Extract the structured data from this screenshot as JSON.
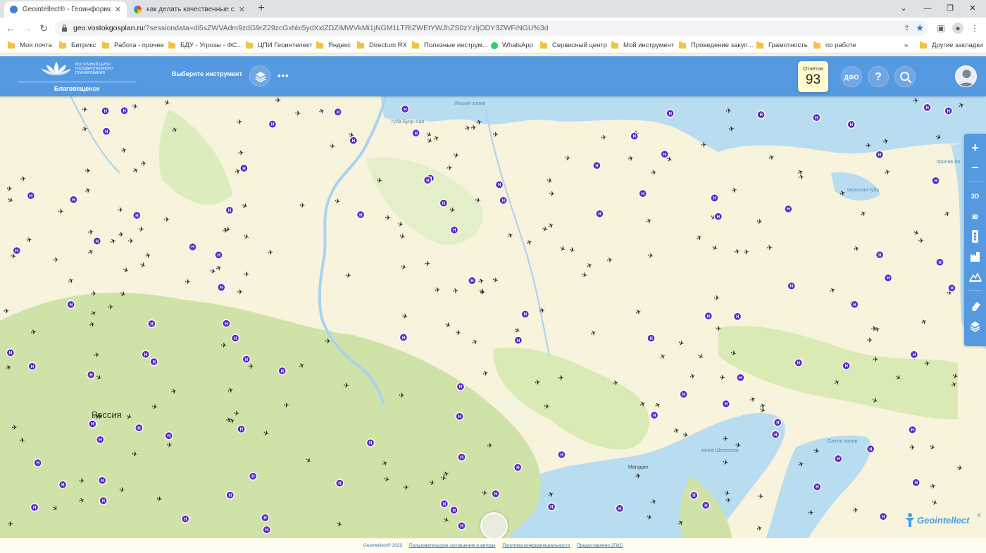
{
  "browser": {
    "tabs": [
      {
        "title": "Geointellect® - Геоинформаци",
        "active": true
      },
      {
        "title": "как делать качественные сним",
        "active": false
      }
    ],
    "url_host": "geo.vostokgosplan.ru",
    "url_path": "/?sessiondata=di5sZWVAdm9zdG9rZ29zcGxhbi5ydXxlZDZiMWVkMi1jNGM1LTRlZWEtYWJhZS0zYzljODY3ZWFiNGU%3d",
    "bookmarks": [
      {
        "label": "Моя почта",
        "icon": "folder-icon"
      },
      {
        "label": "Битрикс",
        "icon": "folder-icon"
      },
      {
        "label": "Работа - прочее",
        "icon": "folder-icon"
      },
      {
        "label": "БДУ - Угрозы - ФС...",
        "icon": "folder-icon"
      },
      {
        "label": "ЦПИ Геоинтелект",
        "icon": "folder-icon"
      },
      {
        "label": "Яндекс",
        "icon": "folder-icon"
      },
      {
        "label": "Directum RX",
        "icon": "folder-icon"
      },
      {
        "label": "Полезные инструм...",
        "icon": "folder-icon"
      },
      {
        "label": "WhatsApp",
        "icon": "whatsapp-icon"
      },
      {
        "label": "Сервисный центр",
        "icon": "folder-icon"
      },
      {
        "label": "Мой инструмент",
        "icon": "folder-icon"
      },
      {
        "label": "Проведение закуп...",
        "icon": "folder-icon"
      },
      {
        "label": "Грамотность",
        "icon": "folder-icon"
      },
      {
        "label": "по работе",
        "icon": "folder-icon"
      }
    ],
    "other_bookmarks": "Другие закладки",
    "more_bookmarks": "»"
  },
  "app": {
    "logo_text": "ВОСТОЧНЫЙ ЦЕНТР ГОСУДАРСТВЕННОГО ПЛАНИРОВАНИЯ",
    "city": "Благовещенск",
    "tool_select": "Выберите инструмент",
    "more": "•••",
    "reports_label": "Отчётов",
    "reports_count": "93",
    "dfo_label": "ДФО",
    "help": "?",
    "colors": {
      "header": "#5599e0",
      "marker_purple": "#5b2bbf",
      "land": "#f7f3dc",
      "forest": "#cfe3a8",
      "water": "#b8dcf0"
    }
  },
  "map": {
    "labels": {
      "russia": "Россия",
      "yana_bay": "Янский залив",
      "buor_khaya": "губа Буор-Хая",
      "chaunskaya": "Чаунская губа",
      "long_strait": "пролив Ло",
      "shelikhov": "залив Шелихова",
      "olyutorsky": "Олюто залив",
      "magadan": "Магадан"
    }
  },
  "controls": {
    "zoom_in": "+",
    "zoom_out": "−",
    "mode_3d": "3D"
  },
  "footer": {
    "copyright": "Geointellect® 2023",
    "terms": "Пользовательское соглашение и авторы",
    "privacy": "Политика конфиденциальности",
    "provider": "Предоставлено 2ГИС"
  },
  "brand": "Geointellect",
  "brand_reg": "®"
}
